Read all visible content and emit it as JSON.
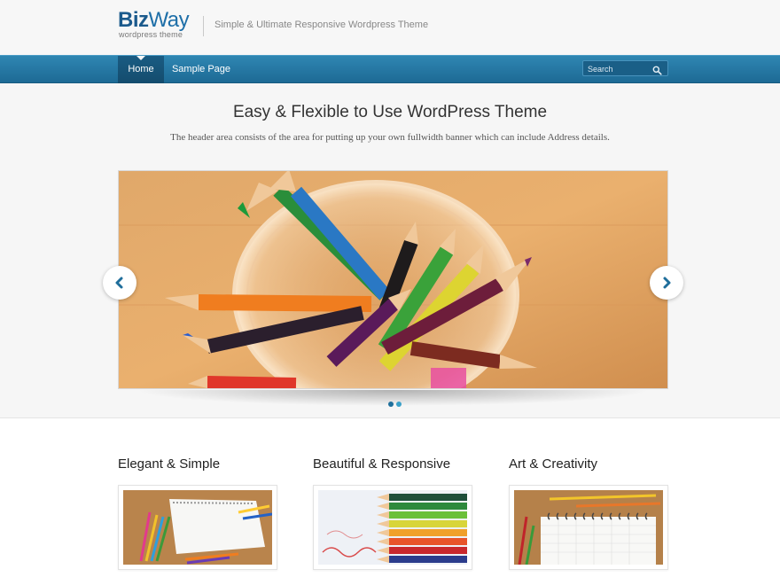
{
  "logo": {
    "part1": "Biz",
    "part2": "Way",
    "subtitle": "wordpress theme"
  },
  "header": {
    "tagline": "Simple & Ultimate Responsive Wordpress Theme"
  },
  "nav": {
    "items": [
      {
        "label": "Home",
        "active": true
      },
      {
        "label": "Sample Page",
        "active": false
      }
    ],
    "search": {
      "placeholder": "Search"
    }
  },
  "intro": {
    "title": "Easy & Flexible to Use WordPress Theme",
    "text": "The header area consists of the area for putting up your own fullwidth banner which can include Address details."
  },
  "slider": {
    "slide_count": 2,
    "active_slide": 1,
    "image_subject": "colored pencils in a glass jar"
  },
  "features": [
    {
      "title": "Elegant & Simple",
      "image_subject": "notepad with colored pencils"
    },
    {
      "title": "Beautiful & Responsive",
      "image_subject": "row of colored pencils"
    },
    {
      "title": "Art & Creativity",
      "image_subject": "spiral notebook with pencils"
    }
  ],
  "colors": {
    "nav_blue": "#2a7fab",
    "nav_active": "#174f72",
    "logo_blue": "#1b5a8c",
    "background": "#f6f6f6"
  },
  "icons": {
    "search": "search-icon",
    "prev": "chevron-left-icon",
    "next": "chevron-right-icon"
  }
}
